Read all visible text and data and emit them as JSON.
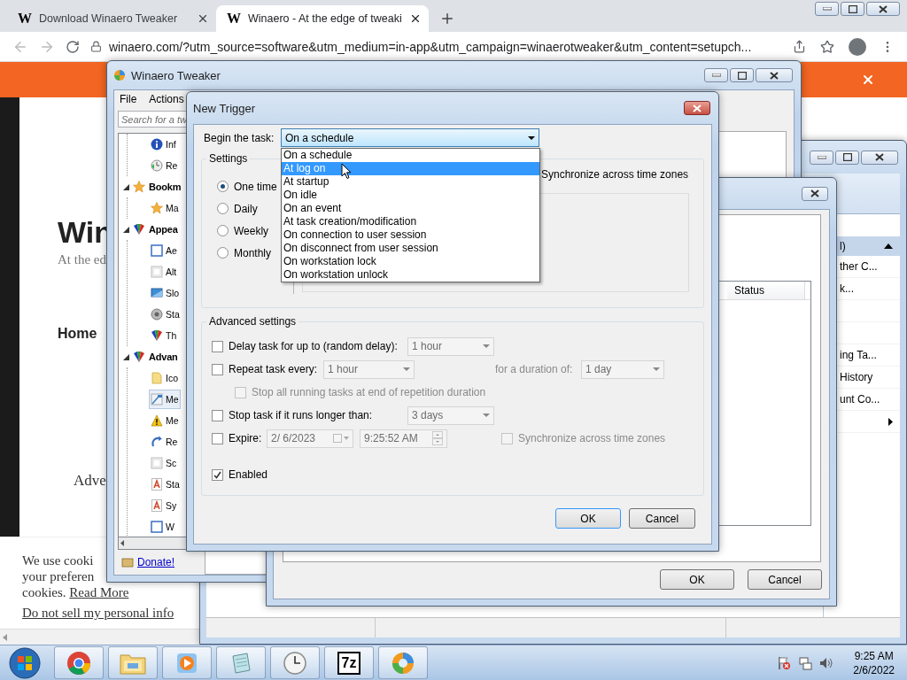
{
  "browser": {
    "tabs": [
      {
        "favicon": "W",
        "title": "Download Winaero Tweaker",
        "selected": false
      },
      {
        "favicon": "W",
        "title": "Winaero - At the edge of tweaki",
        "selected": true
      }
    ],
    "url": "winaero.com/?utm_source=software&utm_medium=in-app&utm_campaign=winaerotweaker&utm_content=setupch...",
    "page": {
      "site_title": "Win",
      "tagline": "At the ed",
      "nav": "Home",
      "heading": "Adve",
      "cookie_lines": [
        "We use cooki",
        "your preferen"
      ],
      "cookie_last": "cookies.",
      "read_more": "Read More",
      "do_not_sell": "Do not sell my personal info"
    }
  },
  "task_scheduler": {
    "actions_header": "l)",
    "actions": [
      {
        "kind": "text",
        "label": "ther C..."
      },
      {
        "kind": "text",
        "label": "k..."
      },
      {
        "kind": "spacer"
      },
      {
        "kind": "spacer"
      },
      {
        "kind": "text",
        "label": "ing Ta..."
      },
      {
        "kind": "text",
        "label": "History"
      },
      {
        "kind": "text",
        "label": "unt Co..."
      },
      {
        "kind": "submenu"
      }
    ]
  },
  "create_task": {
    "status_column": "Status",
    "ok": "OK",
    "cancel": "Cancel"
  },
  "tweaker": {
    "title": "Winaero Tweaker",
    "menu": [
      "File",
      "Actions"
    ],
    "search_placeholder": "Search for a tw",
    "tree": [
      {
        "children": [
          {
            "label": "Inf",
            "kind": "info",
            "selected": false
          },
          {
            "label": "Re",
            "kind": "clock",
            "selected": false
          }
        ]
      },
      {
        "label": "Bookm",
        "kind": "star",
        "expanded": true,
        "children": [
          {
            "label": "Ma",
            "kind": "star",
            "selected": false
          }
        ]
      },
      {
        "label": "Appea",
        "kind": "palette",
        "expanded": true,
        "children": [
          {
            "label": "Ae",
            "kind": "window",
            "selected": false
          },
          {
            "label": "Alt",
            "kind": "frame",
            "selected": false
          },
          {
            "label": "Slo",
            "kind": "monitor",
            "selected": false
          },
          {
            "label": "Sta",
            "kind": "speaker",
            "selected": false
          },
          {
            "label": "Th",
            "kind": "palette",
            "selected": false
          }
        ]
      },
      {
        "label": "Advan",
        "kind": "palette",
        "expanded": true,
        "children": [
          {
            "label": "Ico",
            "kind": "folder",
            "selected": false
          },
          {
            "label": "Me",
            "kind": "cursor",
            "selected": true
          },
          {
            "label": "Me",
            "kind": "warning",
            "selected": false
          },
          {
            "label": "Re",
            "kind": "arrow",
            "selected": false
          },
          {
            "label": "Sc",
            "kind": "frame",
            "selected": false
          },
          {
            "label": "Sta",
            "kind": "font",
            "selected": false
          },
          {
            "label": "Sy",
            "kind": "font",
            "selected": false
          },
          {
            "label": "W",
            "kind": "window",
            "selected": false
          }
        ]
      }
    ],
    "donate": "Donate!"
  },
  "new_trigger": {
    "title": "New Trigger",
    "begin_label": "Begin the task:",
    "begin_value": "On a schedule",
    "dropdown_open": true,
    "options": [
      {
        "label": "On a schedule",
        "selected": false
      },
      {
        "label": "At log on",
        "selected": true
      },
      {
        "label": "At startup",
        "selected": false
      },
      {
        "label": "On idle",
        "selected": false
      },
      {
        "label": "On an event",
        "selected": false
      },
      {
        "label": "At task creation/modification",
        "selected": false
      },
      {
        "label": "On connection to user session",
        "selected": false
      },
      {
        "label": "On disconnect from user session",
        "selected": false
      },
      {
        "label": "On workstation lock",
        "selected": false
      },
      {
        "label": "On workstation unlock",
        "selected": false
      }
    ],
    "settings_label": "Settings",
    "schedule": [
      {
        "label": "One time",
        "selected": true
      },
      {
        "label": "Daily",
        "selected": false
      },
      {
        "label": "Weekly",
        "selected": false
      },
      {
        "label": "Monthly",
        "selected": false
      }
    ],
    "sync_label": "Synchronize across time zones",
    "advanced_label": "Advanced settings",
    "advanced": [
      {
        "kind": "delay",
        "label": "Delay task for up to (random delay):",
        "checked": false,
        "value": "1 hour"
      },
      {
        "kind": "repeat",
        "label": "Repeat task every:",
        "checked": false,
        "value": "1 hour",
        "duration_label": "for a duration of:",
        "duration_value": "1 day"
      },
      {
        "kind": "suboption",
        "label": "Stop all running tasks at end of repetition duration",
        "checked": false,
        "disabled": true
      },
      {
        "kind": "delay",
        "label": "Stop task if it runs longer than:",
        "checked": false,
        "value": "3 days"
      },
      {
        "kind": "expire",
        "label": "Expire:",
        "checked": false,
        "date": "2/ 6/2023",
        "time": "9:25:52 AM",
        "sync_label": "Synchronize across time zones",
        "sync_checked": false
      },
      {
        "kind": "toggle",
        "label": "Enabled",
        "checked": true
      }
    ],
    "ok": "OK",
    "cancel": "Cancel"
  },
  "taskbar": {
    "apps": [
      {
        "kind": "chrome"
      },
      {
        "kind": "explorer"
      },
      {
        "kind": "media"
      },
      {
        "kind": "notepad"
      },
      {
        "kind": "clock"
      },
      {
        "kind": "archiver",
        "label": "7z"
      },
      {
        "kind": "tweaker"
      }
    ],
    "time": "9:25 AM",
    "date": "2/6/2022"
  }
}
